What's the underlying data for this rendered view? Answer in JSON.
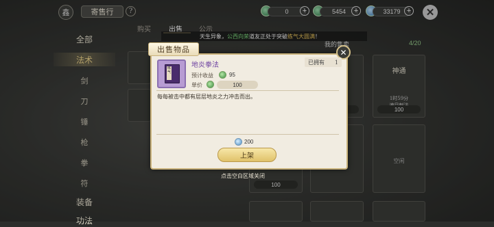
{
  "header": {
    "shop_icon": "鑫",
    "title": "寄售行",
    "help": "?",
    "currencies": [
      {
        "icon": "jade-icon",
        "value": "0"
      },
      {
        "icon": "spirit-stone-icon",
        "value": "5454"
      },
      {
        "icon": "crystal-icon",
        "value": "33179"
      }
    ],
    "plus": "+",
    "close": "✕"
  },
  "sidebar": {
    "items": [
      {
        "label": "全部",
        "active": false,
        "category": true
      },
      {
        "label": "法术",
        "active": true,
        "category": true
      },
      {
        "label": "剑",
        "active": false,
        "category": false
      },
      {
        "label": "刀",
        "active": false,
        "category": false
      },
      {
        "label": "锤",
        "active": false,
        "category": false
      },
      {
        "label": "枪",
        "active": false,
        "category": false
      },
      {
        "label": "拳",
        "active": false,
        "category": false
      },
      {
        "label": "符",
        "active": false,
        "category": false
      },
      {
        "label": "装备",
        "active": false,
        "category": true
      },
      {
        "label": "功法",
        "active": false,
        "category": true
      }
    ]
  },
  "tabs": [
    {
      "label": "购买",
      "active": false
    },
    {
      "label": "出售",
      "active": true
    },
    {
      "label": "公示",
      "active": false
    }
  ],
  "notice": {
    "prefix": "天生异象，",
    "name": "公西向荣",
    "middle": "道友正处于突破",
    "realm": "练气大圆满",
    "suffix": "！"
  },
  "my_sale": {
    "label": "我的售卖",
    "count": "4/20"
  },
  "listings": [
    {
      "title": "神通",
      "subtitle": "1时59分",
      "subtitle2": "速目刺法",
      "price": "100"
    },
    {
      "title": "",
      "subtitle": "",
      "subtitle2": "",
      "price": "100"
    },
    {
      "title": "",
      "subtitle": "",
      "subtitle2": "",
      "price": "100"
    },
    {
      "title": "",
      "subtitle": "空闲",
      "subtitle2": "",
      "price": ""
    }
  ],
  "empty_slot_label": "空闲",
  "dialog": {
    "title": "出售物品",
    "item_name": "地炎拳法",
    "item_tag": "练气",
    "owned_label": "已拥有",
    "owned_count": "1",
    "income_label": "预计收益",
    "income_value": "95",
    "unit_price_label": "单价",
    "unit_price_value": "100",
    "description": "每每被击中都有层层地炎之力冲击而出。",
    "deposit_value": "200",
    "list_button": "上架",
    "close": "✕"
  },
  "hint": "点击空白区域关闭"
}
